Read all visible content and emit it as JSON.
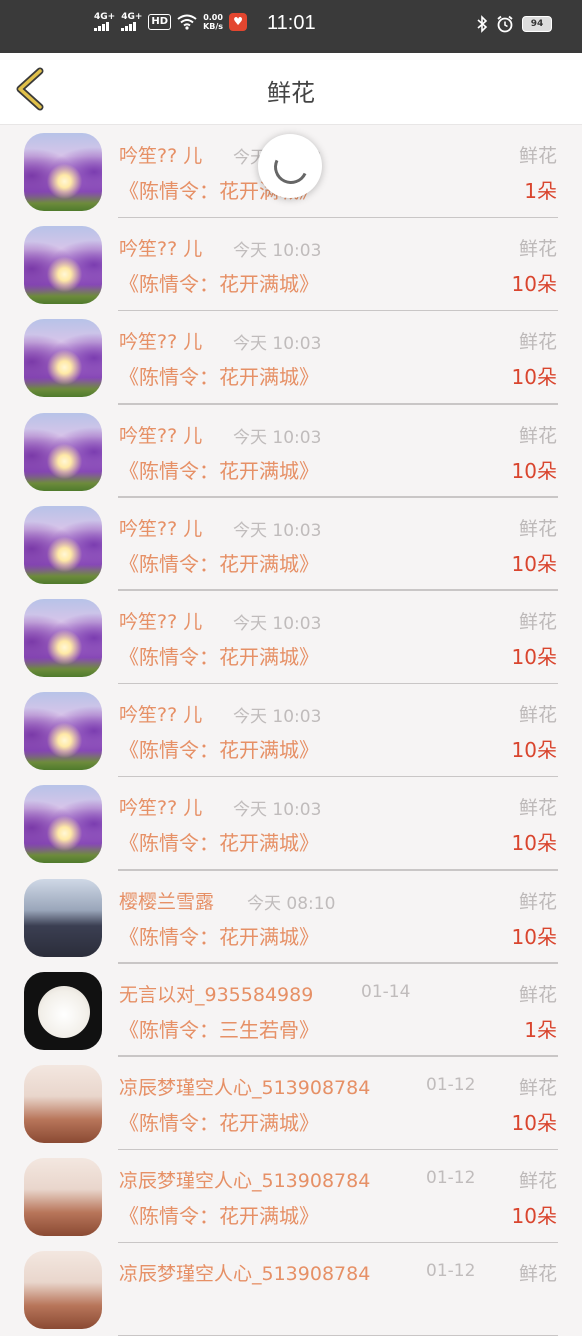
{
  "status_bar": {
    "net1": "4G+",
    "net2": "4G+",
    "hd": "HD",
    "speed_value": "0.00",
    "speed_unit": "KB/s",
    "time": "11:01",
    "battery": "94"
  },
  "header": {
    "title": "鲜花"
  },
  "colors": {
    "accent_name": "#e69066",
    "count_red": "#d9452e",
    "back_arrow": "#e0c04a"
  },
  "items": [
    {
      "name": "吟笙?? 儿",
      "time": "今天 10:03",
      "kind": "鲜花",
      "gift": "《陈情令：花开满城》",
      "count": "1朵",
      "avatar": "lavender-field"
    },
    {
      "name": "吟笙?? 儿",
      "time": "今天 10:03",
      "kind": "鲜花",
      "gift": "《陈情令：花开满城》",
      "count": "10朵",
      "avatar": "lavender-field"
    },
    {
      "name": "吟笙?? 儿",
      "time": "今天 10:03",
      "kind": "鲜花",
      "gift": "《陈情令：花开满城》",
      "count": "10朵",
      "avatar": "lavender-field"
    },
    {
      "name": "吟笙?? 儿",
      "time": "今天 10:03",
      "kind": "鲜花",
      "gift": "《陈情令：花开满城》",
      "count": "10朵",
      "avatar": "lavender-field"
    },
    {
      "name": "吟笙?? 儿",
      "time": "今天 10:03",
      "kind": "鲜花",
      "gift": "《陈情令：花开满城》",
      "count": "10朵",
      "avatar": "lavender-field"
    },
    {
      "name": "吟笙?? 儿",
      "time": "今天 10:03",
      "kind": "鲜花",
      "gift": "《陈情令：花开满城》",
      "count": "10朵",
      "avatar": "lavender-field"
    },
    {
      "name": "吟笙?? 儿",
      "time": "今天 10:03",
      "kind": "鲜花",
      "gift": "《陈情令：花开满城》",
      "count": "10朵",
      "avatar": "lavender-field"
    },
    {
      "name": "吟笙?? 儿",
      "time": "今天 10:03",
      "kind": "鲜花",
      "gift": "《陈情令：花开满城》",
      "count": "10朵",
      "avatar": "lavender-field"
    },
    {
      "name": "樱樱兰雪露",
      "time": "今天 08:10",
      "kind": "鲜花",
      "gift": "《陈情令：花开满城》",
      "count": "10朵",
      "avatar": "anime-boy"
    },
    {
      "name": "无言以对_935584989",
      "time": "01-14",
      "kind": "鲜花",
      "gift": "《陈情令：三生若骨》",
      "count": "1朵",
      "avatar": "white-puppy"
    },
    {
      "name": "凉辰梦瑾空人心_513908784",
      "time": "01-12",
      "kind": "鲜花",
      "gift": "《陈情令：花开满城》",
      "count": "10朵",
      "avatar": "white-hair-anime"
    },
    {
      "name": "凉辰梦瑾空人心_513908784",
      "time": "01-12",
      "kind": "鲜花",
      "gift": "《陈情令：花开满城》",
      "count": "10朵",
      "avatar": "white-hair-anime"
    },
    {
      "name": "凉辰梦瑾空人心_513908784",
      "time": "01-12",
      "kind": "鲜花",
      "gift": "",
      "count": "",
      "avatar": "white-hair-anime"
    }
  ]
}
